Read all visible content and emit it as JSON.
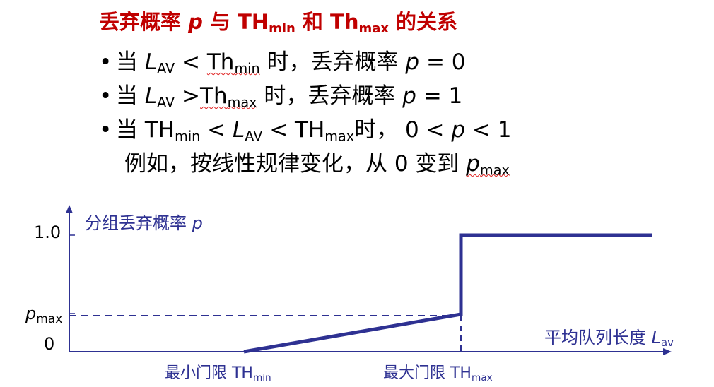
{
  "title": {
    "prefix": "丢弃概率 ",
    "p": "p",
    "mid1": " 与 ",
    "th_min_base": "TH",
    "th_min_sub": "min",
    "mid2": " 和 ",
    "th_max_base": "Th",
    "th_max_sub": "max",
    "suffix": " 的关系"
  },
  "bullets": [
    {
      "bullet": "•",
      "t1": "当 ",
      "L": "L",
      "Lsub": "AV",
      "t2": " < ",
      "base": "Th",
      "sub": "min",
      "t3": " 时，丢弃概率 ",
      "p": "p",
      "t4": " = 0"
    },
    {
      "bullet": "•",
      "t1": "当 ",
      "L": "L",
      "Lsub": "AV",
      "t2": " >",
      "base": "Th",
      "sub": "max",
      "t3": " 时，丢弃概率 ",
      "p": "p",
      "t4": " = 1"
    },
    {
      "bullet": "•",
      "t1": "当 ",
      "base1": "TH",
      "sub1": "min",
      "t2": " < ",
      "L": "L",
      "Lsub": "AV",
      "t3": " < ",
      "base2": "TH",
      "sub2": "max",
      "t4": "时，  0 < ",
      "p": "p",
      "t5": " < 1"
    },
    {
      "t1": "例如，按线性规律变化，从 0 变到 ",
      "p": "p",
      "psub": "max"
    }
  ],
  "diagram": {
    "y_axis_label": "分组丢弃概率 ",
    "y_axis_p": "p",
    "x_axis_label": "平均队列长度 ",
    "x_axis_L": "L",
    "x_axis_sub": "av",
    "tick_1": "1.0",
    "tick_pmax_base": "p",
    "tick_pmax_sub": "max",
    "tick_0": "0",
    "th_min_label": "最小门限 TH",
    "th_min_sub": "min",
    "th_max_label": "最大门限 TH",
    "th_max_sub": "max",
    "colors": {
      "axis": "#2e3192",
      "curve": "#2e3192",
      "title": "#c00000",
      "wavy": "#e02020"
    }
  }
}
